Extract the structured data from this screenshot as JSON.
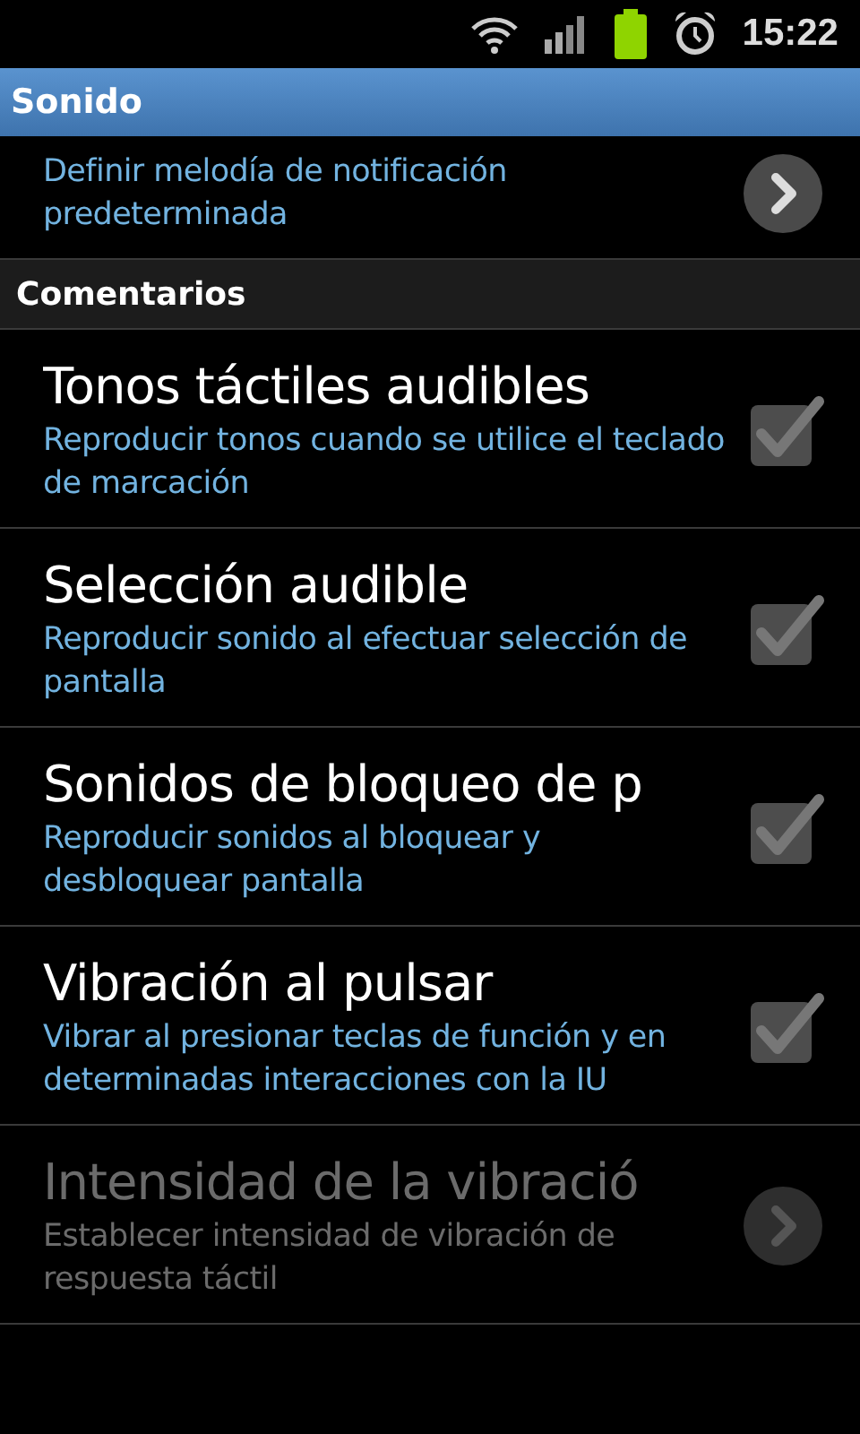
{
  "status_bar": {
    "time": "15:22"
  },
  "header": {
    "title": "Sonido"
  },
  "items": [
    {
      "kind": "link",
      "summary": "Definir melodía de notificación predeterminada",
      "disabled": false
    },
    {
      "kind": "category",
      "title": "Comentarios"
    },
    {
      "kind": "checkbox",
      "title": "Tonos táctiles audibles",
      "summary": "Reproducir tonos cuando se utilice el teclado de marcación",
      "checked": true
    },
    {
      "kind": "checkbox",
      "title": "Selección audible",
      "summary": "Reproducir sonido al efectuar selección de pantalla",
      "checked": true
    },
    {
      "kind": "checkbox",
      "title": "Sonidos de bloqueo de p",
      "summary": "Reproducir sonidos al bloquear y desbloquear pantalla",
      "checked": true
    },
    {
      "kind": "checkbox",
      "title": "Vibración al pulsar",
      "summary": "Vibrar al presionar teclas de función y en determinadas interacciones con la IU",
      "checked": true
    },
    {
      "kind": "link",
      "title": "Intensidad de la vibració",
      "summary": "Establecer intensidad de vibración de respuesta táctil",
      "disabled": true
    }
  ]
}
